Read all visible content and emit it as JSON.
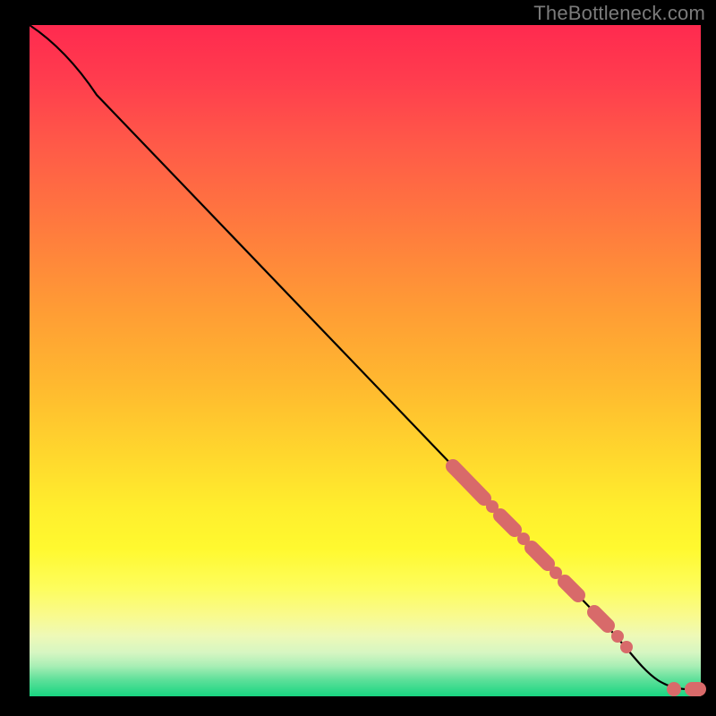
{
  "watermark": "TheBottleneck.com",
  "colors": {
    "gradient_top": "#ff2a4f",
    "gradient_mid": "#ffee2d",
    "gradient_bottom": "#18d581",
    "curve": "#000000",
    "data_point": "#d86a6a",
    "background": "#000000",
    "watermark": "#7b7b7b"
  },
  "chart_data": {
    "type": "line",
    "title": "",
    "xlabel": "",
    "ylabel": "",
    "xlim": [
      0,
      100
    ],
    "ylim": [
      0,
      100
    ],
    "grid": false,
    "legend": null,
    "series": [
      {
        "name": "curve",
        "kind": "line",
        "x": [
          0,
          4,
          10,
          64,
          85,
          89,
          94,
          98,
          100
        ],
        "y": [
          100,
          97,
          90,
          33,
          12,
          8,
          3,
          1,
          1
        ]
      },
      {
        "name": "highlighted-points",
        "kind": "scatter",
        "x": [
          63,
          65,
          68,
          69,
          70,
          72,
          74,
          75,
          77,
          78,
          80,
          82,
          84,
          86,
          88,
          89,
          96,
          99,
          100
        ],
        "y": [
          34,
          32,
          30,
          28,
          27,
          25,
          23,
          22,
          20,
          18,
          17,
          15,
          13,
          12,
          9,
          7,
          1,
          1,
          1
        ]
      }
    ],
    "notes": "Axes are unlabeled; values are normalized 0–100 estimates read from pixel positions. Background is a vertical heat gradient from red (top) through yellow to green (bottom)."
  }
}
